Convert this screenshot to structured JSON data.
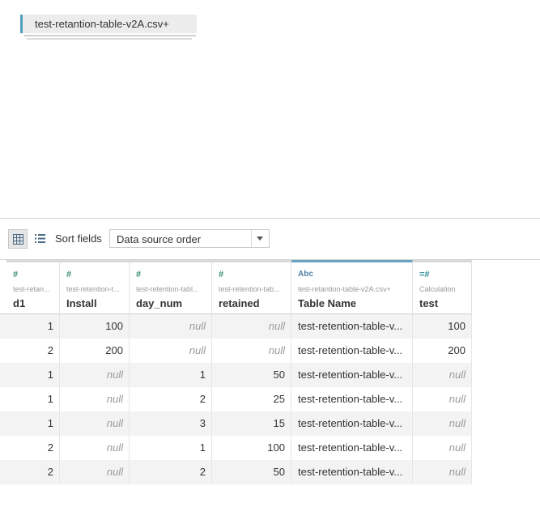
{
  "canvas": {
    "table_pill": "test-retantion-table-v2A.csv+"
  },
  "toolbar": {
    "sort_label": "Sort fields",
    "sort_value": "Data source order",
    "grid_view_icon": "grid-icon",
    "list_view_icon": "list-icon"
  },
  "columns": [
    {
      "type_icon": "#",
      "source": "test-retan...",
      "name": "d1"
    },
    {
      "type_icon": "#",
      "source": "test-retention-t...",
      "name": "Install"
    },
    {
      "type_icon": "#",
      "source": "test-retention-tabl...",
      "name": "day_num"
    },
    {
      "type_icon": "#",
      "source": "test-retention-tab...",
      "name": "retained"
    },
    {
      "type_icon": "Abc",
      "source": "test-retantion-table-v2A.csv+",
      "name": "Table Name"
    },
    {
      "type_icon": "=#",
      "source": "Calculation",
      "name": "test"
    }
  ],
  "rows": [
    [
      "1",
      "100",
      "null",
      "null",
      "test-retention-table-v...",
      "100"
    ],
    [
      "2",
      "200",
      "null",
      "null",
      "test-retention-table-v...",
      "200"
    ],
    [
      "1",
      "null",
      "1",
      "50",
      "test-retention-table-v...",
      "null"
    ],
    [
      "1",
      "null",
      "2",
      "25",
      "test-retention-table-v...",
      "null"
    ],
    [
      "1",
      "null",
      "3",
      "15",
      "test-retention-table-v...",
      "null"
    ],
    [
      "2",
      "null",
      "1",
      "100",
      "test-retention-table-v...",
      "null"
    ],
    [
      "2",
      "null",
      "2",
      "50",
      "test-retention-table-v...",
      "null"
    ]
  ],
  "colors": {
    "accent": "#6aa3c2",
    "pill_border": "#4e9fbf",
    "number_icon": "#3b8f6f"
  }
}
